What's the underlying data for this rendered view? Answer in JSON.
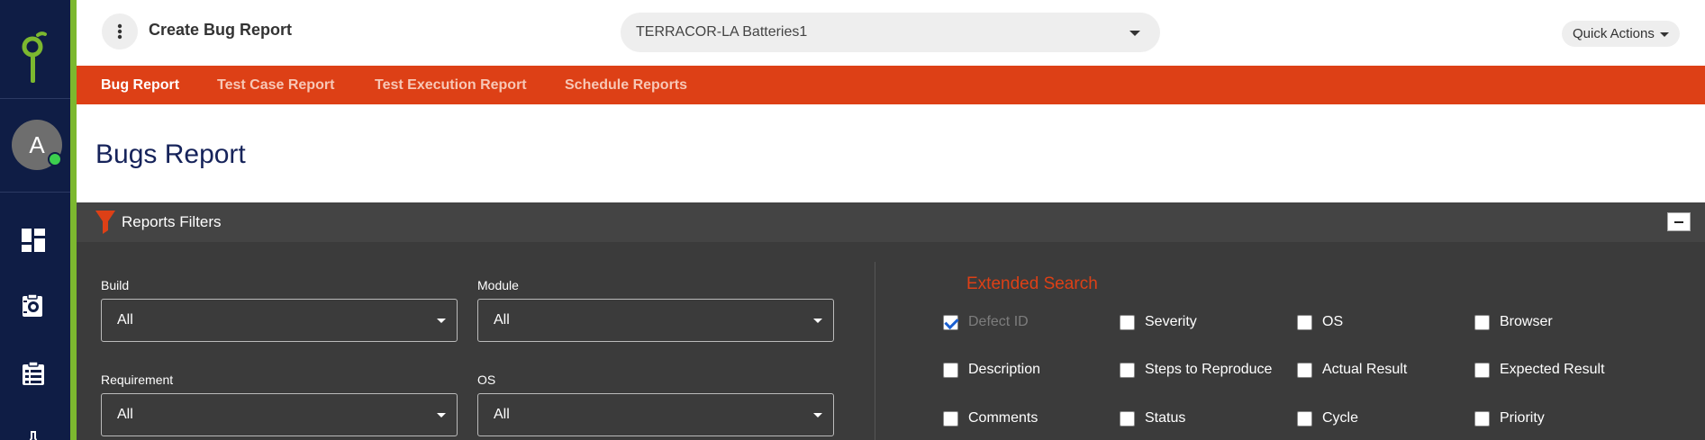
{
  "header": {
    "title": "Create Bug Report",
    "project": "TERRACOR-LA Batteries1",
    "quick_actions": "Quick Actions"
  },
  "sidebar": {
    "avatar_letter": "A",
    "colors": {
      "bg": "#0f1d45",
      "accent": "#7cb82f",
      "online": "#3ccf4e"
    },
    "icons": [
      "dashboard-icon",
      "test-settings-icon",
      "test-cases-icon",
      "lab-flask-icon"
    ]
  },
  "nav": {
    "tabs": [
      {
        "label": "Bug Report",
        "active": true
      },
      {
        "label": "Test Case Report",
        "active": false
      },
      {
        "label": "Test Execution Report",
        "active": false
      },
      {
        "label": "Schedule Reports",
        "active": false
      }
    ],
    "color": "#dd4016"
  },
  "page": {
    "title": "Bugs Report"
  },
  "filters": {
    "header": "Reports Filters",
    "fields": [
      {
        "label": "Build",
        "value": "All"
      },
      {
        "label": "Module",
        "value": "All"
      },
      {
        "label": "Requirement",
        "value": "All"
      },
      {
        "label": "OS",
        "value": "All"
      }
    ],
    "extended": {
      "title": "Extended Search",
      "checkboxes": [
        {
          "label": "Defect ID",
          "checked": true,
          "disabled": true
        },
        {
          "label": "Severity",
          "checked": false
        },
        {
          "label": "OS",
          "checked": false
        },
        {
          "label": "Browser",
          "checked": false
        },
        {
          "label": "Description",
          "checked": false
        },
        {
          "label": "Steps to Reproduce",
          "checked": false
        },
        {
          "label": "Actual Result",
          "checked": false
        },
        {
          "label": "Expected Result",
          "checked": false
        },
        {
          "label": "Comments",
          "checked": false
        },
        {
          "label": "Status",
          "checked": false
        },
        {
          "label": "Cycle",
          "checked": false
        },
        {
          "label": "Priority",
          "checked": false
        }
      ]
    }
  }
}
